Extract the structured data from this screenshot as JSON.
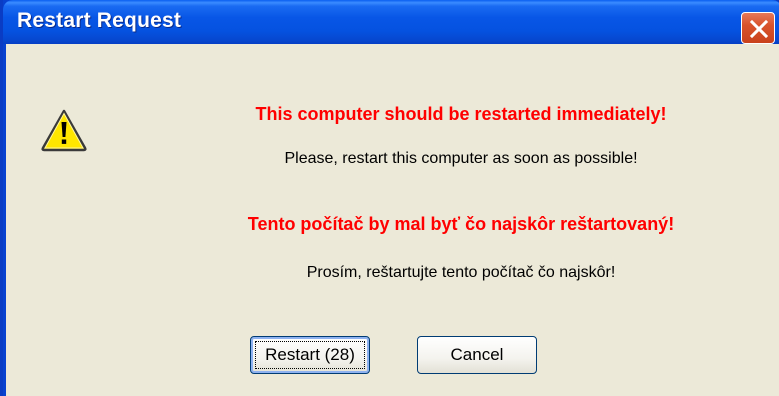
{
  "window": {
    "title": "Restart Request"
  },
  "message": {
    "en_headline": "This computer should be restarted immediately!",
    "en_body": "Please, restart this computer as soon as possible!",
    "sk_headline": "Tento počítač by mal byť čo najskôr reštartovaný!",
    "sk_body": "Prosím, reštartujte tento počítač čo najskôr!"
  },
  "buttons": {
    "restart_label": "Restart (28)",
    "cancel_label": "Cancel"
  },
  "icons": {
    "warning": "warning-triangle-icon",
    "close": "close-x-icon"
  },
  "colors": {
    "headline": "#ff0000",
    "titlebar": "#0552e0",
    "dialog_bg": "#ece9d8",
    "close_button": "#d9532c"
  }
}
